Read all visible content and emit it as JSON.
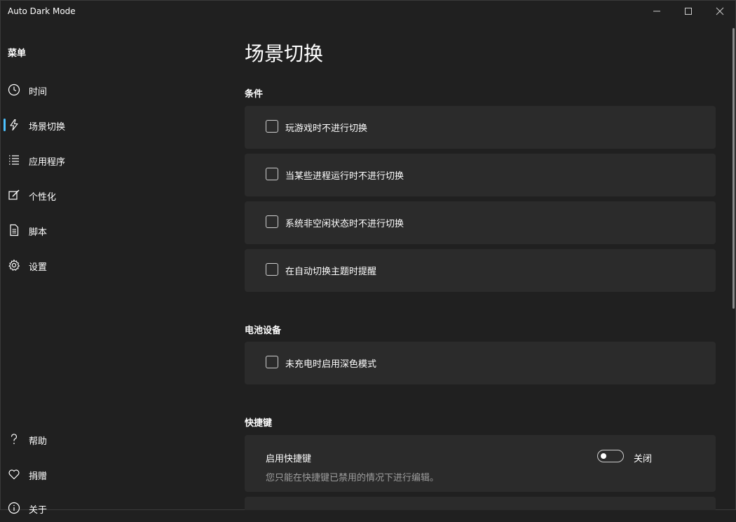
{
  "app": {
    "title": "Auto Dark Mode"
  },
  "sidebar": {
    "header": "菜单",
    "items": [
      {
        "label": "时间",
        "icon": "clock-icon",
        "selected": false
      },
      {
        "label": "场景切换",
        "icon": "lightning-icon",
        "selected": true
      },
      {
        "label": "应用程序",
        "icon": "list-icon",
        "selected": false
      },
      {
        "label": "个性化",
        "icon": "edit-icon",
        "selected": false
      },
      {
        "label": "脚本",
        "icon": "document-icon",
        "selected": false
      },
      {
        "label": "设置",
        "icon": "gear-icon",
        "selected": false
      }
    ],
    "footer_items": [
      {
        "label": "帮助",
        "icon": "question-icon"
      },
      {
        "label": "捐赠",
        "icon": "heart-icon"
      },
      {
        "label": "关于",
        "icon": "info-icon"
      }
    ]
  },
  "main": {
    "title": "场景切换",
    "sections": {
      "conditions": {
        "title": "条件",
        "options": [
          {
            "label": "玩游戏时不进行切换",
            "checked": false
          },
          {
            "label": "当某些进程运行时不进行切换",
            "checked": false
          },
          {
            "label": "系统非空闲状态时不进行切换",
            "checked": false
          },
          {
            "label": "在自动切换主题时提醒",
            "checked": false
          }
        ]
      },
      "battery": {
        "title": "电池设备",
        "options": [
          {
            "label": "未充电时启用深色模式",
            "checked": false
          }
        ]
      },
      "hotkeys": {
        "title": "快捷键",
        "enable_label": "启用快捷键",
        "description": "您只能在快捷键已禁用的情况下进行编辑。",
        "toggle_state": "关闭",
        "toggle_on": false
      }
    }
  },
  "colors": {
    "accent": "#4cc2ff",
    "background": "#202020",
    "card": "#2b2b2b"
  }
}
